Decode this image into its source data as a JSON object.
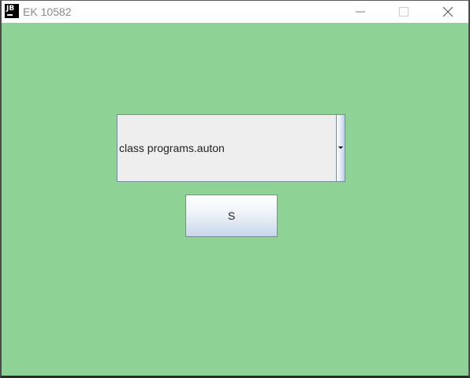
{
  "window": {
    "title": "EK 10582",
    "icon_text": "JB",
    "icon": "jetbrains-icon",
    "controls": {
      "minimize_icon": "minimize-icon",
      "maximize_icon": "maximize-icon",
      "close_icon": "close-icon"
    }
  },
  "colors": {
    "background": "#8fd296",
    "titlebar": "#ffffff",
    "control_face": "#eeeeee"
  },
  "combo": {
    "selected_value": "class programs.auton",
    "arrow_icon": "chevron-down-icon"
  },
  "button": {
    "label": "S"
  }
}
